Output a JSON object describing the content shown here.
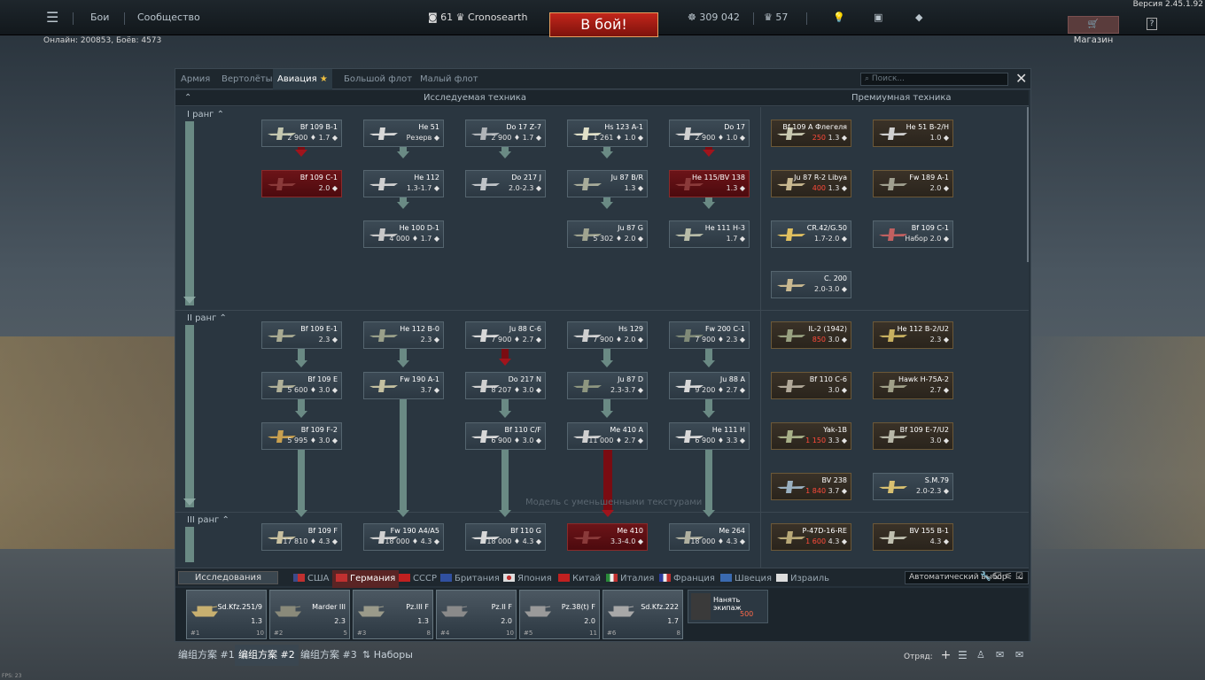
{
  "version": "Версия 2.45.1.92",
  "online": "Онлайн: 200853, Боёв: 4573",
  "fps": "FPS: 23",
  "topbar": {
    "battles": "Бои",
    "community": "Сообщество",
    "player_level": "61",
    "player_name": "Cronosearth",
    "battle_button": "В бой!",
    "silver_lions": "309 042",
    "golden_eagles": "57",
    "shop": "Магазин",
    "help": "?"
  },
  "tabs": [
    "Армия",
    "Вертолёты",
    "Авиация",
    "Большой флот",
    "Малый флот"
  ],
  "active_tab": "Авиация",
  "search_placeholder": "Поиск...",
  "columns": {
    "researched": "Исследуемая техника",
    "premium": "Премиумная техника"
  },
  "ranks": [
    "I ранг",
    "II ранг",
    "III ранг"
  ],
  "rank1": [
    {
      "name": "Bf 109 B-1",
      "stats": "2 900 ♦ 1.7 ◆"
    },
    {
      "name": "He 51",
      "stats": "Резерв ◆"
    },
    {
      "name": "Do 17 Z-7",
      "stats": "2 900 ♦ 1.7 ◆"
    },
    {
      "name": "Hs 123 A-1",
      "stats": "1 261 ♦ 1.0 ◆"
    },
    {
      "name": "Do 17",
      "stats": "2 900 ♦ 1.0 ◆"
    },
    {
      "name": "Bf 109 C-1",
      "stats": "2.0 ◆"
    },
    {
      "name": "He 112",
      "stats": "1.3-1.7 ◆"
    },
    {
      "name": "Do 217 J",
      "stats": "2.0-2.3 ◆"
    },
    {
      "name": "Ju 87 B/R",
      "stats": "1.3 ◆"
    },
    {
      "name": "He 115/BV 138",
      "stats": "1.3 ◆"
    },
    {
      "name": "He 100 D-1",
      "stats": "4 000 ♦ 1.7 ◆"
    },
    {
      "name": "Ju 87 G",
      "stats": "5 302 ♦ 2.0 ◆"
    },
    {
      "name": "He 111 H-3",
      "stats": "1.7 ◆"
    }
  ],
  "rank1_premium": [
    {
      "name": "Bf 109 A Флегеля",
      "stats_cost": "250",
      "stats_br": "1.3 ◆"
    },
    {
      "name": "He 51 B-2/H",
      "stats": "1.0 ◆"
    },
    {
      "name": "Ju 87 R-2 Libya",
      "stats_cost": "400",
      "stats_br": "1.3 ◆"
    },
    {
      "name": "Fw 189 A-1",
      "stats": "2.0 ◆"
    },
    {
      "name": "CR.42/G.50",
      "stats": "1.7-2.0 ◆"
    },
    {
      "name": "Bf 109 C-1",
      "stats": "Набор 2.0 ◆"
    },
    {
      "name": "C. 200",
      "stats": "2.0-3.0 ◆"
    }
  ],
  "rank2": [
    {
      "name": "Bf 109 E-1",
      "stats": "2.3 ◆"
    },
    {
      "name": "He 112 B-0",
      "stats": "2.3 ◆"
    },
    {
      "name": "Ju 88 C-6",
      "stats": "7 900 ♦ 2.7 ◆"
    },
    {
      "name": "Hs 129",
      "stats": "7 900 ♦ 2.0 ◆"
    },
    {
      "name": "Fw 200 C-1",
      "stats": "7 900 ♦ 2.3 ◆"
    },
    {
      "name": "Bf 109 E",
      "stats": "5 600 ♦ 3.0 ◆"
    },
    {
      "name": "Fw 190 A-1",
      "stats": "3.7 ◆"
    },
    {
      "name": "Do 217 N",
      "stats": "8 207 ♦ 3.0 ◆"
    },
    {
      "name": "Ju 87 D",
      "stats": "2.3-3.7 ◆"
    },
    {
      "name": "Ju 88 A",
      "stats": "9 200 ♦ 2.7 ◆"
    },
    {
      "name": "Bf 109 F-2",
      "stats": "5 995 ♦ 3.0 ◆"
    },
    {
      "name": "Bf 110 C/F",
      "stats": "6 900 ♦ 3.0 ◆"
    },
    {
      "name": "Me 410 A",
      "stats": "11 000 ♦ 2.7 ◆"
    },
    {
      "name": "He 111 H",
      "stats": "6 900 ♦ 3.3 ◆"
    }
  ],
  "rank2_premium": [
    {
      "name": "IL-2 (1942)",
      "stats_cost": "850",
      "stats_br": "3.0 ◆"
    },
    {
      "name": "He 112 B-2/U2",
      "stats": "2.3 ◆"
    },
    {
      "name": "Bf 110 C-6",
      "stats": "3.0 ◆"
    },
    {
      "name": "Hawk H-75A-2",
      "stats": "2.7 ◆"
    },
    {
      "name": "Yak-1B",
      "stats_cost": "1 150",
      "stats_br": "3.3 ◆"
    },
    {
      "name": "Bf 109 E-7/U2",
      "stats": "3.0 ◆"
    },
    {
      "name": "BV 238",
      "stats_cost": "1 840",
      "stats_br": "3.7 ◆"
    },
    {
      "name": "S.M.79",
      "stats": "2.0-2.3 ◆"
    }
  ],
  "rank3": [
    {
      "name": "Bf 109 F",
      "stats": "17 810 ♦ 4.3 ◆"
    },
    {
      "name": "Fw 190 A4/A5",
      "stats": "18 000 ♦ 4.3 ◆"
    },
    {
      "name": "Bf 110 G",
      "stats": "18 000 ♦ 4.3 ◆"
    },
    {
      "name": "Me 410",
      "stats": "3.3-4.0 ◆"
    },
    {
      "name": "Me 264",
      "stats": "18 000 ♦ 4.3 ◆"
    }
  ],
  "rank3_premium": [
    {
      "name": "P-47D-16-RE",
      "stats_cost": "1 600",
      "stats_br": "4.3 ◆"
    },
    {
      "name": "BV 155 B-1",
      "stats": "4.3 ◆"
    }
  ],
  "ghost_text": "Модель с уменьшенными текстурами",
  "research_button": "Исследования",
  "auto_select": "Автоматический выбор",
  "nations": [
    "США",
    "Германия",
    "СССР",
    "Британия",
    "Япония",
    "Китай",
    "Италия",
    "Франция",
    "Швеция",
    "Израиль"
  ],
  "active_nation": "Германия",
  "crew": [
    {
      "name": "Sd.Kfz.251/9",
      "br": "1.3",
      "num": "1",
      "lvl": "10"
    },
    {
      "name": "Marder III",
      "br": "2.3",
      "num": "2",
      "lvl": "5"
    },
    {
      "name": "Pz.III F",
      "br": "1.3",
      "num": "3",
      "lvl": "8"
    },
    {
      "name": "Pz.II F",
      "br": "2.0",
      "num": "4",
      "lvl": "10"
    },
    {
      "name": "Pz.38(t) F",
      "br": "2.0",
      "num": "5",
      "lvl": "11"
    },
    {
      "name": "Sd.Kfz.222",
      "br": "1.7",
      "num": "6",
      "lvl": "8"
    }
  ],
  "hire": {
    "label": "Нанять экипаж",
    "cost": "500"
  },
  "presets": [
    "编组方案 #1",
    "编组方案 #2",
    "编组方案 #3",
    "Наборы"
  ],
  "active_preset": "编组方案 #2",
  "squad": "Отряд:"
}
